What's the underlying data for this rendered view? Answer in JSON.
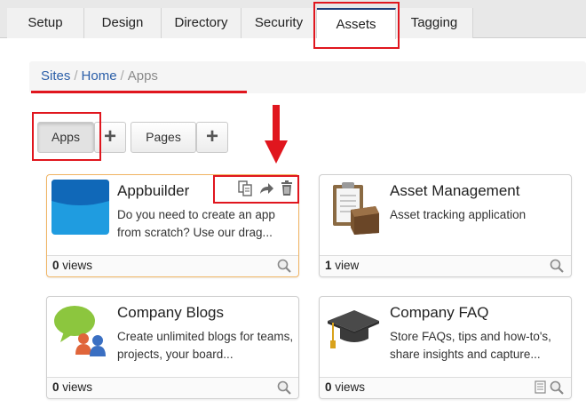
{
  "tabs": [
    {
      "label": "Setup"
    },
    {
      "label": "Design"
    },
    {
      "label": "Directory"
    },
    {
      "label": "Security"
    },
    {
      "label": "Assets",
      "active": true
    },
    {
      "label": "Tagging"
    }
  ],
  "breadcrumb": {
    "items": [
      "Sites",
      "Home"
    ],
    "current": "Apps",
    "separator": "/"
  },
  "toolbar": {
    "apps_label": "Apps",
    "pages_label": "Pages",
    "add_symbol": "+"
  },
  "cards": [
    {
      "title": "Appbuilder",
      "description": "Do you need to create an app from scratch? Use our drag...",
      "views_count": "0",
      "views_word": "views"
    },
    {
      "title": "Asset Management",
      "description": "Asset tracking application",
      "views_count": "1",
      "views_word": "view"
    },
    {
      "title": "Company Blogs",
      "description": "Create unlimited blogs for teams, projects, your board...",
      "views_count": "0",
      "views_word": "views"
    },
    {
      "title": "Company FAQ",
      "description": "Store FAQs, tips and how-to's, share insights and capture...",
      "views_count": "0",
      "views_word": "views"
    }
  ],
  "colors": {
    "highlight": "#e0161e",
    "link": "#2a5ea8",
    "active_tab_border": "#1f3f7a",
    "card_highlight_border": "#f0b463"
  },
  "icons": [
    "copy-icon",
    "share-icon",
    "trash-icon",
    "search-icon",
    "document-icon",
    "plus-icon"
  ]
}
